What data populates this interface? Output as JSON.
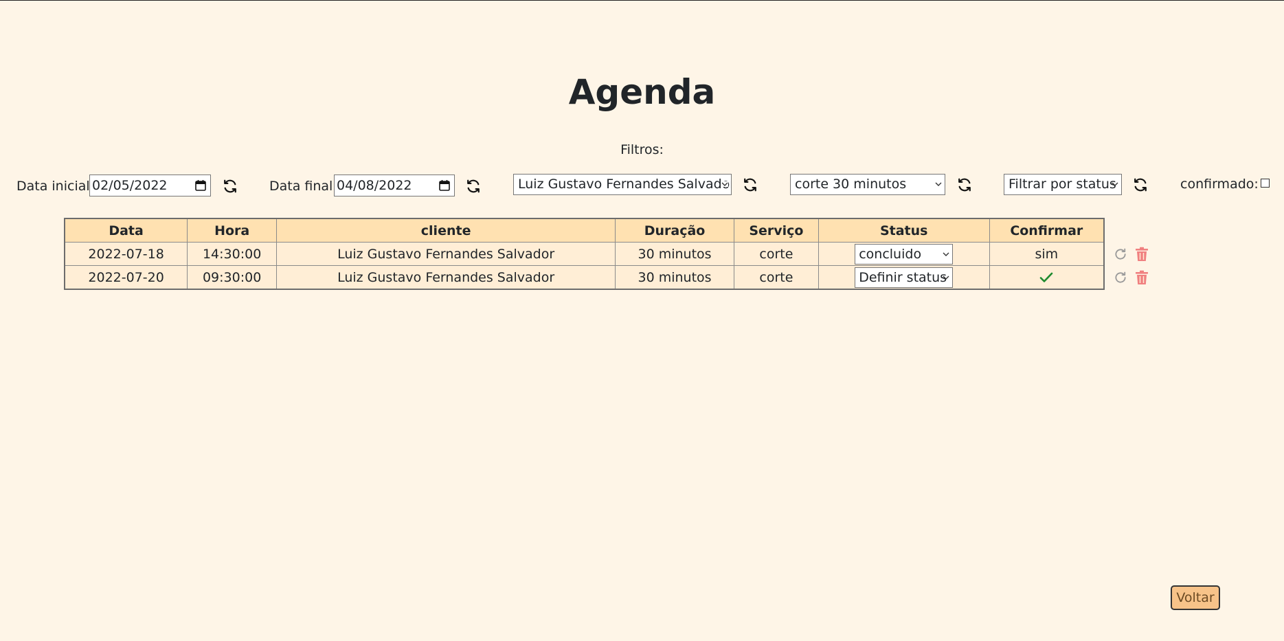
{
  "page": {
    "title": "Agenda",
    "filters_label": "Filtros:"
  },
  "filters": {
    "start_date_label": "Data inicial:",
    "start_date_value": "02/05/2022",
    "end_date_label": "Data final:",
    "end_date_value": "04/08/2022",
    "client_select": "Luiz Gustavo Fernandes Salvador",
    "service_select": "corte 30 minutos",
    "status_select": "Filtrar por status",
    "confirmed_label": "confirmado:"
  },
  "table": {
    "headers": [
      "Data",
      "Hora",
      "cliente",
      "Duração",
      "Serviço",
      "Status",
      "Confirmar"
    ],
    "rows": [
      {
        "data": "2022-07-18",
        "hora": "14:30:00",
        "cliente": "Luiz Gustavo Fernandes Salvador",
        "duracao": "30 minutos",
        "servico": "corte",
        "status": "concluido",
        "confirmar": "sim"
      },
      {
        "data": "2022-07-20",
        "hora": "09:30:00",
        "cliente": "Luiz Gustavo Fernandes Salvador",
        "duracao": "30 minutos",
        "servico": "corte",
        "status": "Definir status",
        "confirmar": "check-icon"
      }
    ]
  },
  "actions": {
    "back_label": "Voltar"
  },
  "colors": {
    "background": "#fef5e7",
    "table_header": "#ffe1b1",
    "table_cell": "#ffeed6",
    "back_button": "#f7c389",
    "delete_icon": "#f08080",
    "check_icon": "#1e8a2e"
  }
}
